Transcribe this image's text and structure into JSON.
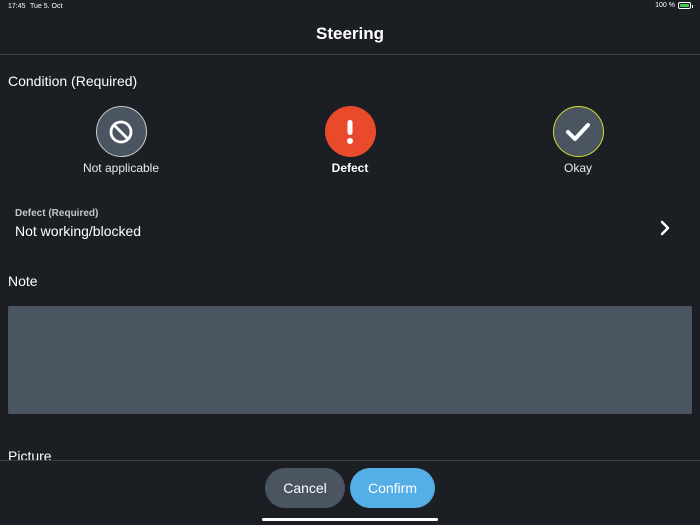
{
  "status_bar": {
    "time": "17:45",
    "date": "Tue 5. Oct",
    "battery_percent": "100 %",
    "battery_level": 1.0,
    "battery_color": "#3fd05a"
  },
  "header": {
    "title": "Steering"
  },
  "condition": {
    "label": "Condition (Required)",
    "selected": "defect",
    "options": [
      {
        "id": "not-applicable",
        "label": "Not applicable",
        "icon": "prohibited-icon",
        "color": "#4b5561"
      },
      {
        "id": "defect",
        "label": "Defect",
        "icon": "exclamation-icon",
        "color": "#ea4a2c"
      },
      {
        "id": "okay",
        "label": "Okay",
        "icon": "checkmark-icon",
        "color": "#4b5561",
        "ring_color": "#cfe22d"
      }
    ]
  },
  "defect": {
    "caption": "Defect (Required)",
    "value": "Not working/blocked",
    "icon": "chevron-right-icon"
  },
  "note": {
    "label": "Note",
    "value": ""
  },
  "picture": {
    "label": "Picture"
  },
  "footer": {
    "cancel_label": "Cancel",
    "confirm_label": "Confirm",
    "confirm_color": "#55aee6"
  }
}
